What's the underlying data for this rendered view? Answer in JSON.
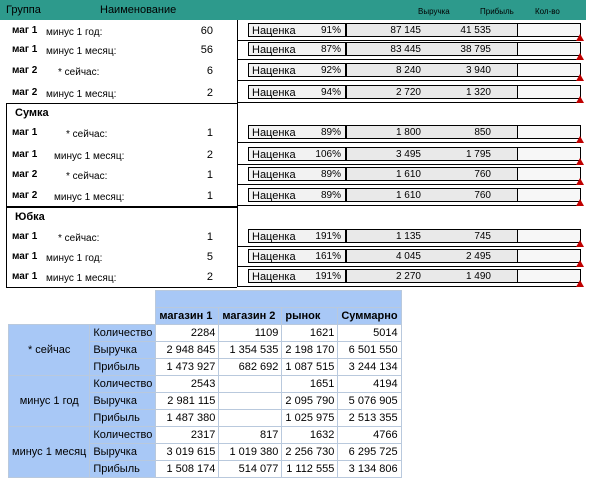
{
  "header": {
    "group": "Группа",
    "name": "Наименование",
    "revenue": "Выручка",
    "profit": "Прибыль",
    "count": "Кол-во"
  },
  "sections": [
    {
      "title": "",
      "rows": [
        {
          "group": "маг 1",
          "name": "минус 1 год:",
          "qty": "60",
          "metric": "Наценка",
          "pct": "91%",
          "rev": "87 145",
          "prof": "41 535"
        },
        {
          "group": "маг 1",
          "name": "минус 1 месяц:",
          "qty": "56",
          "metric": "Наценка",
          "pct": "87%",
          "rev": "83 445",
          "prof": "38 795"
        },
        {
          "group": "маг 2",
          "name": "* сейчас:",
          "qty": "6",
          "metric": "Наценка",
          "pct": "92%",
          "rev": "8 240",
          "prof": "3 940"
        },
        {
          "group": "маг 2",
          "name": "минус 1 месяц:",
          "qty": "2",
          "metric": "Наценка",
          "pct": "94%",
          "rev": "2 720",
          "prof": "1 320"
        }
      ]
    },
    {
      "title": "Сумка",
      "rows": [
        {
          "group": "маг 1",
          "name": "* сейчас:",
          "qty": "1",
          "metric": "Наценка",
          "pct": "89%",
          "rev": "1 800",
          "prof": "850"
        },
        {
          "group": "маг 1",
          "name": "минус 1 месяц:",
          "qty": "2",
          "metric": "Наценка",
          "pct": "106%",
          "rev": "3 495",
          "prof": "1 795"
        },
        {
          "group": "маг 2",
          "name": "* сейчас:",
          "qty": "1",
          "metric": "Наценка",
          "pct": "89%",
          "rev": "1 610",
          "prof": "760"
        },
        {
          "group": "маг 2",
          "name": "минус 1 месяц:",
          "qty": "1",
          "metric": "Наценка",
          "pct": "89%",
          "rev": "1 610",
          "prof": "760"
        }
      ]
    },
    {
      "title": "Юбка",
      "rows": [
        {
          "group": "маг 1",
          "name": "* сейчас:",
          "qty": "1",
          "metric": "Наценка",
          "pct": "191%",
          "rev": "1 135",
          "prof": "745"
        },
        {
          "group": "маг 1",
          "name": "минус 1 год:",
          "qty": "5",
          "metric": "Наценка",
          "pct": "161%",
          "rev": "4 045",
          "prof": "2 495"
        },
        {
          "group": "маг 1",
          "name": "минус 1 месяц:",
          "qty": "2",
          "metric": "Наценка",
          "pct": "191%",
          "rev": "2 270",
          "prof": "1 490"
        }
      ]
    }
  ],
  "pivot": {
    "columns": [
      "магазин 1",
      "магазин 2",
      "рынок",
      "Суммарно"
    ],
    "groups": [
      {
        "label": "* сейчас",
        "measures": [
          {
            "name": "Количество",
            "vals": [
              "2284",
              "1109",
              "1621",
              "5014"
            ]
          },
          {
            "name": "Выручка",
            "vals": [
              "2 948 845",
              "1 354 535",
              "2 198 170",
              "6 501 550"
            ]
          },
          {
            "name": "Прибыль",
            "vals": [
              "1 473 927",
              "682 692",
              "1 087 515",
              "3 244 134"
            ]
          }
        ]
      },
      {
        "label": "минус 1 год",
        "measures": [
          {
            "name": "Количество",
            "vals": [
              "2543",
              "",
              "1651",
              "4194"
            ]
          },
          {
            "name": "Выручка",
            "vals": [
              "2 981 115",
              "",
              "2 095 790",
              "5 076 905"
            ]
          },
          {
            "name": "Прибыль",
            "vals": [
              "1 487 380",
              "",
              "1 025 975",
              "2 513 355"
            ]
          }
        ]
      },
      {
        "label": "минус 1 месяц",
        "measures": [
          {
            "name": "Количество",
            "vals": [
              "2317",
              "817",
              "1632",
              "4766"
            ]
          },
          {
            "name": "Выручка",
            "vals": [
              "3 019 615",
              "1 019 380",
              "2 256 730",
              "6 295 725"
            ]
          },
          {
            "name": "Прибыль",
            "vals": [
              "1 508 174",
              "514 077",
              "1 112 555",
              "3 134 806"
            ]
          }
        ]
      }
    ]
  }
}
